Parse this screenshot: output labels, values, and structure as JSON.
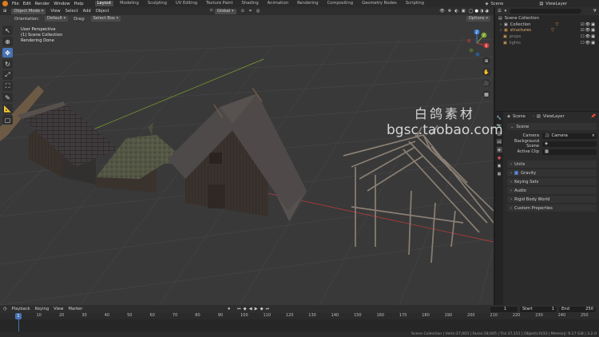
{
  "menubar": {
    "menus": [
      "File",
      "Edit",
      "Render",
      "Window",
      "Help"
    ],
    "workspaces": [
      "Layout",
      "Modeling",
      "Sculpting",
      "UV Editing",
      "Texture Paint",
      "Shading",
      "Animation",
      "Rendering",
      "Compositing",
      "Geometry Nodes",
      "Scripting"
    ],
    "active_workspace": "Layout",
    "scene_label": "Scene",
    "viewlayer_label": "ViewLayer"
  },
  "viewport": {
    "mode": "Object Mode",
    "menus": [
      "View",
      "Select",
      "Add",
      "Object"
    ],
    "transform": "Global",
    "options_label": "Options",
    "orientation_label": "Orientation:",
    "orientation_value": "Default",
    "drag_label": "Drag:",
    "drag_value": "Select Box",
    "overlay_lines": [
      "User Perspective",
      "(1) Scene Collection",
      "Rendering Done"
    ],
    "gizmo_axes": {
      "x": "X",
      "y": "Y",
      "z": "Z"
    }
  },
  "outliner": {
    "root": "Scene Collection",
    "items": [
      {
        "name": "Collection",
        "color": "#c7c7c7"
      },
      {
        "name": "structures",
        "color": "#d49a4a"
      },
      {
        "name": "props",
        "color": "#d8a35a"
      },
      {
        "name": "lights",
        "color": "#d8a35a"
      }
    ]
  },
  "properties": {
    "breadcrumb_scene": "Scene",
    "breadcrumb_layer": "ViewLayer",
    "scene_panel": "Scene",
    "camera_label": "Camera",
    "camera_value": "Camera",
    "bg_scene_label": "Background Scene",
    "active_clip_label": "Active Clip",
    "panels": [
      "Units",
      "Gravity",
      "Keying Sets",
      "Audio",
      "Rigid Body World",
      "Custom Properties"
    ]
  },
  "timeline": {
    "menus": [
      "Playback",
      "Keying",
      "View",
      "Marker"
    ],
    "current_frame": "1",
    "start_label": "Start",
    "start_value": "1",
    "end_label": "End",
    "end_value": "250",
    "ticks": [
      "1",
      "10",
      "20",
      "30",
      "40",
      "50",
      "60",
      "70",
      "80",
      "90",
      "100",
      "110",
      "120",
      "130",
      "140",
      "150",
      "160",
      "170",
      "180",
      "190",
      "200",
      "210",
      "220",
      "230",
      "240",
      "250"
    ]
  },
  "statusbar": {
    "text": "Scene Collection | Verts:27,003 | Faces:18,045 | Tris:37,151 | Objects:0/33 | Memory: 9.17 GiB | 3.2.0"
  },
  "watermark": {
    "line1": "白鸽素材",
    "line2": "bgsc.taobao.com"
  },
  "colors": {
    "accent": "#4772b3",
    "axis_x": "#c93a3a",
    "axis_y": "#7aa332",
    "logo": "#e07d1c"
  }
}
